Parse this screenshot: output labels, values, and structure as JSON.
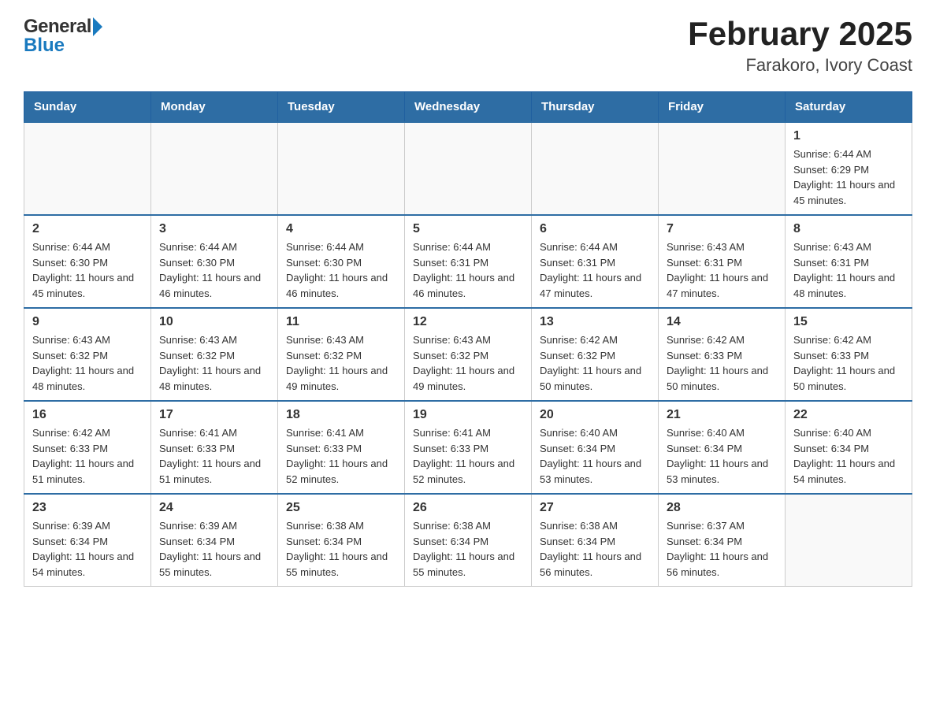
{
  "header": {
    "title": "February 2025",
    "subtitle": "Farakoro, Ivory Coast"
  },
  "logo": {
    "general": "General",
    "blue": "Blue"
  },
  "days": [
    "Sunday",
    "Monday",
    "Tuesday",
    "Wednesday",
    "Thursday",
    "Friday",
    "Saturday"
  ],
  "weeks": [
    [
      {
        "day": "",
        "info": ""
      },
      {
        "day": "",
        "info": ""
      },
      {
        "day": "",
        "info": ""
      },
      {
        "day": "",
        "info": ""
      },
      {
        "day": "",
        "info": ""
      },
      {
        "day": "",
        "info": ""
      },
      {
        "day": "1",
        "info": "Sunrise: 6:44 AM\nSunset: 6:29 PM\nDaylight: 11 hours and 45 minutes."
      }
    ],
    [
      {
        "day": "2",
        "info": "Sunrise: 6:44 AM\nSunset: 6:30 PM\nDaylight: 11 hours and 45 minutes."
      },
      {
        "day": "3",
        "info": "Sunrise: 6:44 AM\nSunset: 6:30 PM\nDaylight: 11 hours and 46 minutes."
      },
      {
        "day": "4",
        "info": "Sunrise: 6:44 AM\nSunset: 6:30 PM\nDaylight: 11 hours and 46 minutes."
      },
      {
        "day": "5",
        "info": "Sunrise: 6:44 AM\nSunset: 6:31 PM\nDaylight: 11 hours and 46 minutes."
      },
      {
        "day": "6",
        "info": "Sunrise: 6:44 AM\nSunset: 6:31 PM\nDaylight: 11 hours and 47 minutes."
      },
      {
        "day": "7",
        "info": "Sunrise: 6:43 AM\nSunset: 6:31 PM\nDaylight: 11 hours and 47 minutes."
      },
      {
        "day": "8",
        "info": "Sunrise: 6:43 AM\nSunset: 6:31 PM\nDaylight: 11 hours and 48 minutes."
      }
    ],
    [
      {
        "day": "9",
        "info": "Sunrise: 6:43 AM\nSunset: 6:32 PM\nDaylight: 11 hours and 48 minutes."
      },
      {
        "day": "10",
        "info": "Sunrise: 6:43 AM\nSunset: 6:32 PM\nDaylight: 11 hours and 48 minutes."
      },
      {
        "day": "11",
        "info": "Sunrise: 6:43 AM\nSunset: 6:32 PM\nDaylight: 11 hours and 49 minutes."
      },
      {
        "day": "12",
        "info": "Sunrise: 6:43 AM\nSunset: 6:32 PM\nDaylight: 11 hours and 49 minutes."
      },
      {
        "day": "13",
        "info": "Sunrise: 6:42 AM\nSunset: 6:32 PM\nDaylight: 11 hours and 50 minutes."
      },
      {
        "day": "14",
        "info": "Sunrise: 6:42 AM\nSunset: 6:33 PM\nDaylight: 11 hours and 50 minutes."
      },
      {
        "day": "15",
        "info": "Sunrise: 6:42 AM\nSunset: 6:33 PM\nDaylight: 11 hours and 50 minutes."
      }
    ],
    [
      {
        "day": "16",
        "info": "Sunrise: 6:42 AM\nSunset: 6:33 PM\nDaylight: 11 hours and 51 minutes."
      },
      {
        "day": "17",
        "info": "Sunrise: 6:41 AM\nSunset: 6:33 PM\nDaylight: 11 hours and 51 minutes."
      },
      {
        "day": "18",
        "info": "Sunrise: 6:41 AM\nSunset: 6:33 PM\nDaylight: 11 hours and 52 minutes."
      },
      {
        "day": "19",
        "info": "Sunrise: 6:41 AM\nSunset: 6:33 PM\nDaylight: 11 hours and 52 minutes."
      },
      {
        "day": "20",
        "info": "Sunrise: 6:40 AM\nSunset: 6:34 PM\nDaylight: 11 hours and 53 minutes."
      },
      {
        "day": "21",
        "info": "Sunrise: 6:40 AM\nSunset: 6:34 PM\nDaylight: 11 hours and 53 minutes."
      },
      {
        "day": "22",
        "info": "Sunrise: 6:40 AM\nSunset: 6:34 PM\nDaylight: 11 hours and 54 minutes."
      }
    ],
    [
      {
        "day": "23",
        "info": "Sunrise: 6:39 AM\nSunset: 6:34 PM\nDaylight: 11 hours and 54 minutes."
      },
      {
        "day": "24",
        "info": "Sunrise: 6:39 AM\nSunset: 6:34 PM\nDaylight: 11 hours and 55 minutes."
      },
      {
        "day": "25",
        "info": "Sunrise: 6:38 AM\nSunset: 6:34 PM\nDaylight: 11 hours and 55 minutes."
      },
      {
        "day": "26",
        "info": "Sunrise: 6:38 AM\nSunset: 6:34 PM\nDaylight: 11 hours and 55 minutes."
      },
      {
        "day": "27",
        "info": "Sunrise: 6:38 AM\nSunset: 6:34 PM\nDaylight: 11 hours and 56 minutes."
      },
      {
        "day": "28",
        "info": "Sunrise: 6:37 AM\nSunset: 6:34 PM\nDaylight: 11 hours and 56 minutes."
      },
      {
        "day": "",
        "info": ""
      }
    ]
  ]
}
